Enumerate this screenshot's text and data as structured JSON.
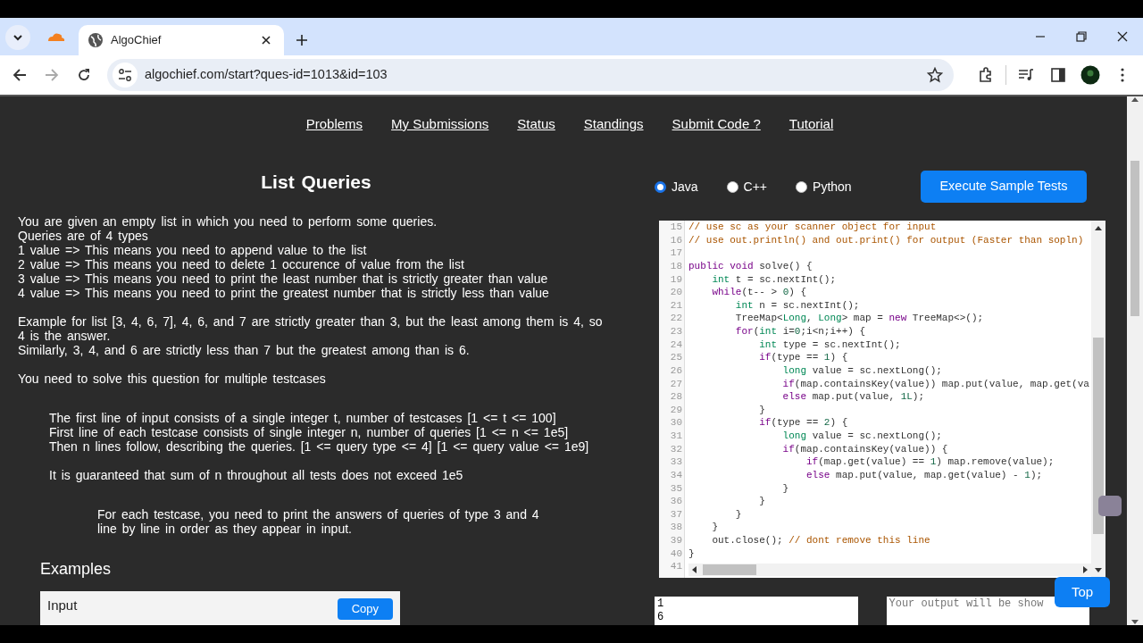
{
  "browser": {
    "tabs": [
      {
        "selected": false
      },
      {
        "title": "AlgoChief",
        "selected": true
      }
    ],
    "url": "algochief.com/start?ques-id=1013&id=103",
    "forward_disabled": true
  },
  "nav": [
    "Problems",
    "My Submissions",
    "Status",
    "Standings",
    "Submit Code ?",
    "Tutorial"
  ],
  "problem": {
    "title": "List Queries",
    "blocks": [
      {
        "kind": "statement",
        "paragraphs": [
          [
            "You are given an empty list in which you need to perform some queries.",
            "Queries are of 4 types",
            "1 value => This means you need to append value to the list",
            "2 value => This means you need to delete 1 occurence of value from the list",
            "3 value => This means you need to print the least number that is strictly greater than value",
            "4 value => This means you need to print the greatest number that is strictly less than value"
          ],
          [
            "Example for list [3, 4, 6, 7], 4, 6, and 7 are strictly greater than 3, but the least among them is 4, so 4 is the answer.",
            "Similarly, 3, 4, and 6 are strictly less than 7 but the greatest among than is 6."
          ],
          [
            "You need to solve this question for multiple testcases"
          ]
        ]
      },
      {
        "kind": "input",
        "paragraphs": [
          [
            "The first line of input consists of a single integer t, number of testcases [1 <= t <= 100]",
            "First line of each testcase consists of single integer n, number of queries [1 <= n <= 1e5]",
            "Then n lines follow, describing the queries. [1 <= query type <= 4] [1 <= query value <= 1e9]"
          ],
          [
            "It is guaranteed that sum of n throughout all tests does not exceed 1e5"
          ]
        ]
      },
      {
        "kind": "output",
        "paragraphs": [
          [
            "For each testcase, you need to print the answers of queries of type 3 and 4",
            "line by line in order as they appear in input."
          ]
        ]
      }
    ],
    "examples": {
      "heading": "Examples",
      "input_label": "Input",
      "copy_label": "Copy"
    }
  },
  "languages": [
    {
      "label": "Java",
      "selected": true
    },
    {
      "label": "C++",
      "selected": false
    },
    {
      "label": "Python",
      "selected": false
    }
  ],
  "execute_label": "Execute Sample Tests",
  "editor": {
    "lines": [
      {
        "number": "15",
        "segments": [
          {
            "kind": "comment",
            "text": "// use sc as your scanner object for input"
          }
        ]
      },
      {
        "number": "16",
        "segments": [
          {
            "kind": "comment",
            "text": "// use out.println() and out.print() for output (Faster than sopln)"
          }
        ]
      },
      {
        "number": "17"
      },
      {
        "number": "18",
        "segments": [
          {
            "kind": "keyword",
            "text": "public "
          },
          {
            "kind": "keyword",
            "text": "void"
          },
          {
            "kind": "plain",
            "text": " solve() {"
          }
        ]
      },
      {
        "number": "19",
        "segments": [
          {
            "kind": "type",
            "text": "    int"
          },
          {
            "kind": "plain",
            "text": " t = sc.nextInt();"
          }
        ]
      },
      {
        "number": "20",
        "segments": [
          {
            "kind": "keyword",
            "text": "    while"
          },
          {
            "kind": "plain",
            "text": "(t-- > "
          },
          {
            "kind": "number",
            "text": "0"
          },
          {
            "kind": "plain",
            "text": ") {"
          }
        ]
      },
      {
        "number": "21",
        "segments": [
          {
            "kind": "type",
            "text": "        int"
          },
          {
            "kind": "plain",
            "text": " n = sc.nextInt();"
          }
        ]
      },
      {
        "number": "22",
        "segments": [
          {
            "kind": "plain",
            "text": "        TreeMap<"
          },
          {
            "kind": "type",
            "text": "Long"
          },
          {
            "kind": "plain",
            "text": ", "
          },
          {
            "kind": "type",
            "text": "Long"
          },
          {
            "kind": "plain",
            "text": "> map = "
          },
          {
            "kind": "keyword",
            "text": "new"
          },
          {
            "kind": "plain",
            "text": " TreeMap<>();"
          }
        ]
      },
      {
        "number": "23",
        "segments": [
          {
            "kind": "keyword",
            "text": "        for"
          },
          {
            "kind": "plain",
            "text": "("
          },
          {
            "kind": "type",
            "text": "int"
          },
          {
            "kind": "plain",
            "text": " i="
          },
          {
            "kind": "number",
            "text": "0"
          },
          {
            "kind": "plain",
            "text": ";i<n;i++) {"
          }
        ]
      },
      {
        "number": "24",
        "segments": [
          {
            "kind": "type",
            "text": "            int"
          },
          {
            "kind": "plain",
            "text": " type = sc.nextInt();"
          }
        ]
      },
      {
        "number": "25",
        "segments": [
          {
            "kind": "keyword",
            "text": "            if"
          },
          {
            "kind": "plain",
            "text": "(type == "
          },
          {
            "kind": "number",
            "text": "1"
          },
          {
            "kind": "plain",
            "text": ") {"
          }
        ]
      },
      {
        "number": "26",
        "segments": [
          {
            "kind": "type",
            "text": "                long"
          },
          {
            "kind": "plain",
            "text": " value = sc.nextLong();"
          }
        ]
      },
      {
        "number": "27",
        "segments": [
          {
            "kind": "keyword",
            "text": "                if"
          },
          {
            "kind": "plain",
            "text": "(map.containsKey(value)) map.put(value, map.get(va"
          }
        ]
      },
      {
        "number": "28",
        "segments": [
          {
            "kind": "keyword",
            "text": "                else"
          },
          {
            "kind": "plain",
            "text": " map.put(value, "
          },
          {
            "kind": "number",
            "text": "1L"
          },
          {
            "kind": "plain",
            "text": ");"
          }
        ]
      },
      {
        "number": "29",
        "segments": [
          {
            "kind": "plain",
            "text": "            }"
          }
        ]
      },
      {
        "number": "30",
        "segments": [
          {
            "kind": "keyword",
            "text": "            if"
          },
          {
            "kind": "plain",
            "text": "(type == "
          },
          {
            "kind": "number",
            "text": "2"
          },
          {
            "kind": "plain",
            "text": ") {"
          }
        ]
      },
      {
        "number": "31",
        "segments": [
          {
            "kind": "type",
            "text": "                long"
          },
          {
            "kind": "plain",
            "text": " value = sc.nextLong();"
          }
        ]
      },
      {
        "number": "32",
        "segments": [
          {
            "kind": "keyword",
            "text": "                if"
          },
          {
            "kind": "plain",
            "text": "(map.containsKey(value)) {"
          }
        ]
      },
      {
        "number": "33",
        "segments": [
          {
            "kind": "keyword",
            "text": "                    if"
          },
          {
            "kind": "plain",
            "text": "(map.get(value) == "
          },
          {
            "kind": "number",
            "text": "1"
          },
          {
            "kind": "plain",
            "text": ") map.remove(value);"
          }
        ]
      },
      {
        "number": "34",
        "segments": [
          {
            "kind": "keyword",
            "text": "                    else"
          },
          {
            "kind": "plain",
            "text": " map.put(value, map.get(value) - "
          },
          {
            "kind": "number",
            "text": "1"
          },
          {
            "kind": "plain",
            "text": ");"
          }
        ]
      },
      {
        "number": "35",
        "segments": [
          {
            "kind": "plain",
            "text": "                }"
          }
        ]
      },
      {
        "number": "36",
        "segments": [
          {
            "kind": "plain",
            "text": "            }"
          }
        ]
      },
      {
        "number": "37",
        "segments": [
          {
            "kind": "plain",
            "text": "        }"
          }
        ]
      },
      {
        "number": "38",
        "segments": [
          {
            "kind": "plain",
            "text": "    }"
          }
        ]
      },
      {
        "number": "39",
        "segments": [
          {
            "kind": "plain",
            "text": "    out.close(); "
          },
          {
            "kind": "comment",
            "text": "// dont remove this line"
          }
        ]
      },
      {
        "number": "40",
        "segments": [
          {
            "kind": "plain",
            "text": "}"
          }
        ]
      },
      {
        "number": "41"
      }
    ]
  },
  "io": {
    "input_value": "1\n6",
    "output_placeholder": "Your output will be show"
  },
  "top_label": "Top"
}
